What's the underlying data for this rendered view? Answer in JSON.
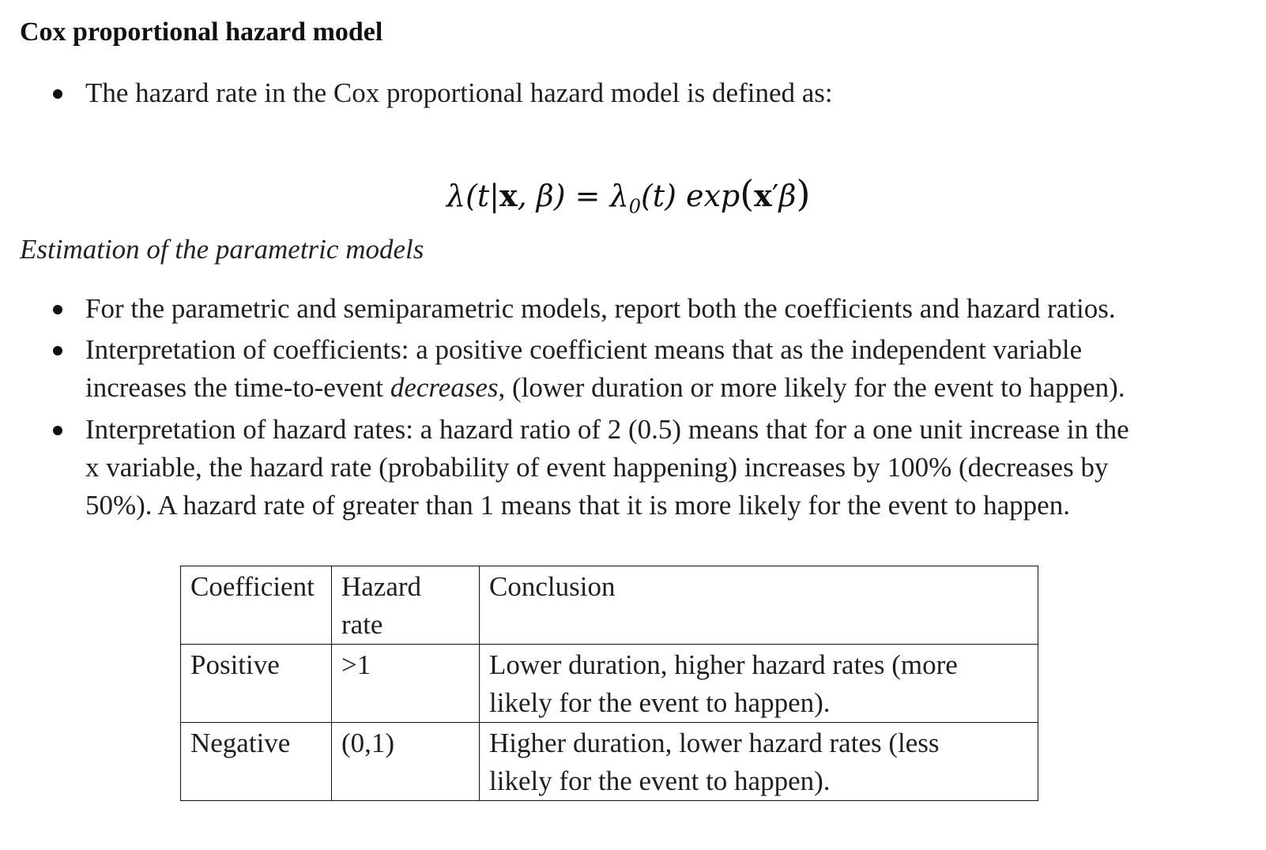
{
  "heading": "Cox proportional hazard model",
  "intro_bullet": "The hazard rate in the Cox proportional hazard model is defined as:",
  "formula": {
    "lhs": "λ(t|",
    "x": "x",
    "mid": ", β) = λ",
    "sub": "0",
    "rhs": "(t) exp",
    "open": "(",
    "xprime": "x",
    "prime": "′",
    "beta": "β",
    "close": ")"
  },
  "subheading": "Estimation of the parametric models",
  "bullets": [
    {
      "lines": [
        "For the parametric and semiparametric models, report both the coefficients and hazard ratios."
      ]
    },
    {
      "line1": "Interpretation of coefficients: a positive coefficient means that as the independent variable",
      "line2_pre": "increases the time-to-event ",
      "line2_em": "decreases",
      "line2_post": ", (lower duration or more likely for the event to happen)."
    },
    {
      "lines": [
        "Interpretation of hazard rates: a hazard ratio of 2 (0.5) means that for a one unit increase in the",
        "x variable, the hazard rate (probability of event happening) increases by 100% (decreases by",
        "50%).  A hazard rate of greater than 1 means that it is more likely for the event to happen."
      ]
    }
  ],
  "table": {
    "headers": [
      "Coefficient",
      "Hazard",
      "rate",
      "Conclusion"
    ],
    "rows": [
      {
        "coefficient": "Positive",
        "hazard": ">1",
        "conclusion_lines": [
          "Lower duration, higher hazard rates (more",
          "likely for the event to happen)."
        ]
      },
      {
        "coefficient": "Negative",
        "hazard": "(0,1)",
        "conclusion_lines": [
          "Higher duration, lower hazard rates (less",
          "likely for the event to happen)."
        ]
      }
    ]
  }
}
